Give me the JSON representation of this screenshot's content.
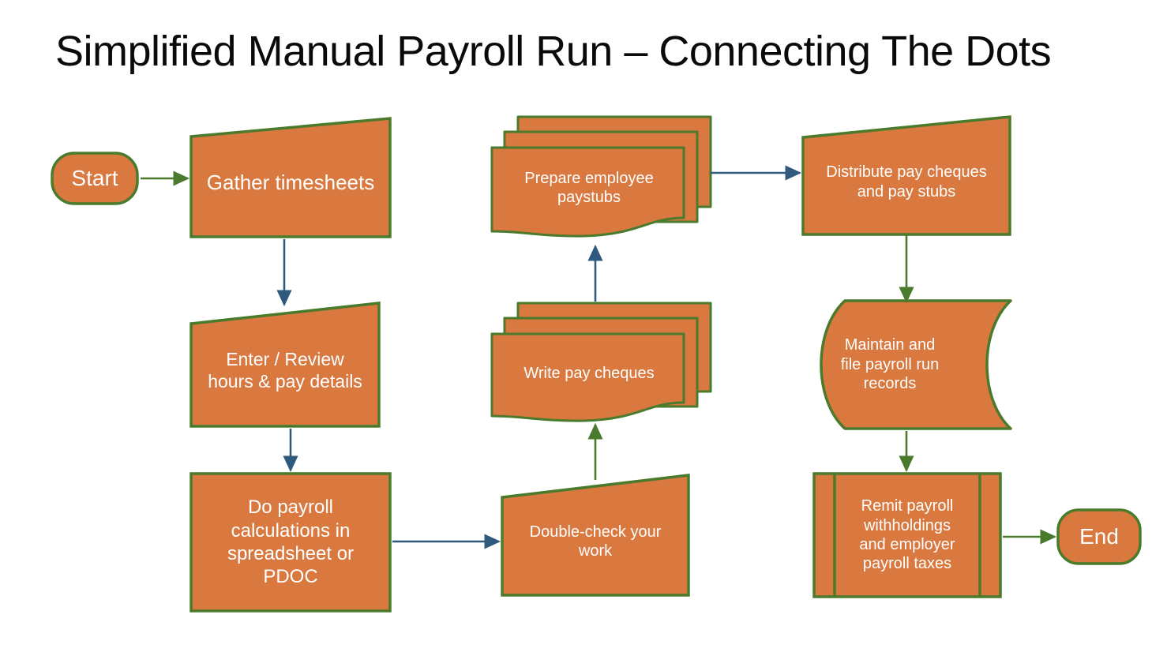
{
  "title": "Simplified Manual Payroll Run – Connecting The Dots",
  "colors": {
    "fill": "#d9783f",
    "stroke": "#4a7a2c",
    "arrow_green": "#4a7a2c",
    "arrow_blue": "#2f5a7e",
    "text": "#ffffff",
    "title_text": "#0a0a0a",
    "background": "#ffffff"
  },
  "nodes": [
    {
      "id": "start",
      "shape": "terminator",
      "label": "Start",
      "font_size": 28
    },
    {
      "id": "gather",
      "shape": "manual-input",
      "label": "Gather timesheets",
      "font_size": 26
    },
    {
      "id": "enter",
      "shape": "manual-input",
      "label": "Enter / Review\nhours & pay details",
      "font_size": 23
    },
    {
      "id": "calculate",
      "shape": "process",
      "label": "Do payroll\ncalculations in\nspreadsheet or\nPDOC",
      "font_size": 24
    },
    {
      "id": "doublecheck",
      "shape": "manual-input",
      "label": "Double-check your\nwork",
      "font_size": 20
    },
    {
      "id": "cheques",
      "shape": "multi-document",
      "label": "Write pay cheques",
      "font_size": 20
    },
    {
      "id": "paystubs",
      "shape": "multi-document",
      "label": "Prepare employee\npaystubs",
      "font_size": 20
    },
    {
      "id": "distribute",
      "shape": "manual-input",
      "label": "Distribute pay cheques\nand pay stubs",
      "font_size": 20
    },
    {
      "id": "maintain",
      "shape": "stored-data",
      "label": "Maintain and\nfile payroll run\nrecords",
      "font_size": 20
    },
    {
      "id": "remit",
      "shape": "predefined-process",
      "label": "Remit payroll\nwithholdings\nand employer\npayroll taxes",
      "font_size": 20
    },
    {
      "id": "end",
      "shape": "terminator",
      "label": "End",
      "font_size": 28
    }
  ],
  "edges": [
    {
      "id": "start-gather",
      "from": "start",
      "to": "gather",
      "color": "green",
      "direction": "right"
    },
    {
      "id": "gather-enter",
      "from": "gather",
      "to": "enter",
      "color": "blue",
      "direction": "down"
    },
    {
      "id": "enter-calculate",
      "from": "enter",
      "to": "calculate",
      "color": "blue",
      "direction": "down"
    },
    {
      "id": "calculate-doublecheck",
      "from": "calculate",
      "to": "doublecheck",
      "color": "blue",
      "direction": "right"
    },
    {
      "id": "doublecheck-cheques",
      "from": "doublecheck",
      "to": "cheques",
      "color": "green",
      "direction": "up"
    },
    {
      "id": "cheques-paystubs",
      "from": "cheques",
      "to": "paystubs",
      "color": "blue",
      "direction": "up"
    },
    {
      "id": "paystubs-distribute",
      "from": "paystubs",
      "to": "distribute",
      "color": "blue",
      "direction": "right"
    },
    {
      "id": "distribute-maintain",
      "from": "distribute",
      "to": "maintain",
      "color": "green",
      "direction": "down"
    },
    {
      "id": "maintain-remit",
      "from": "maintain",
      "to": "remit",
      "color": "green",
      "direction": "down"
    },
    {
      "id": "remit-end",
      "from": "remit",
      "to": "end",
      "color": "green",
      "direction": "right"
    }
  ]
}
